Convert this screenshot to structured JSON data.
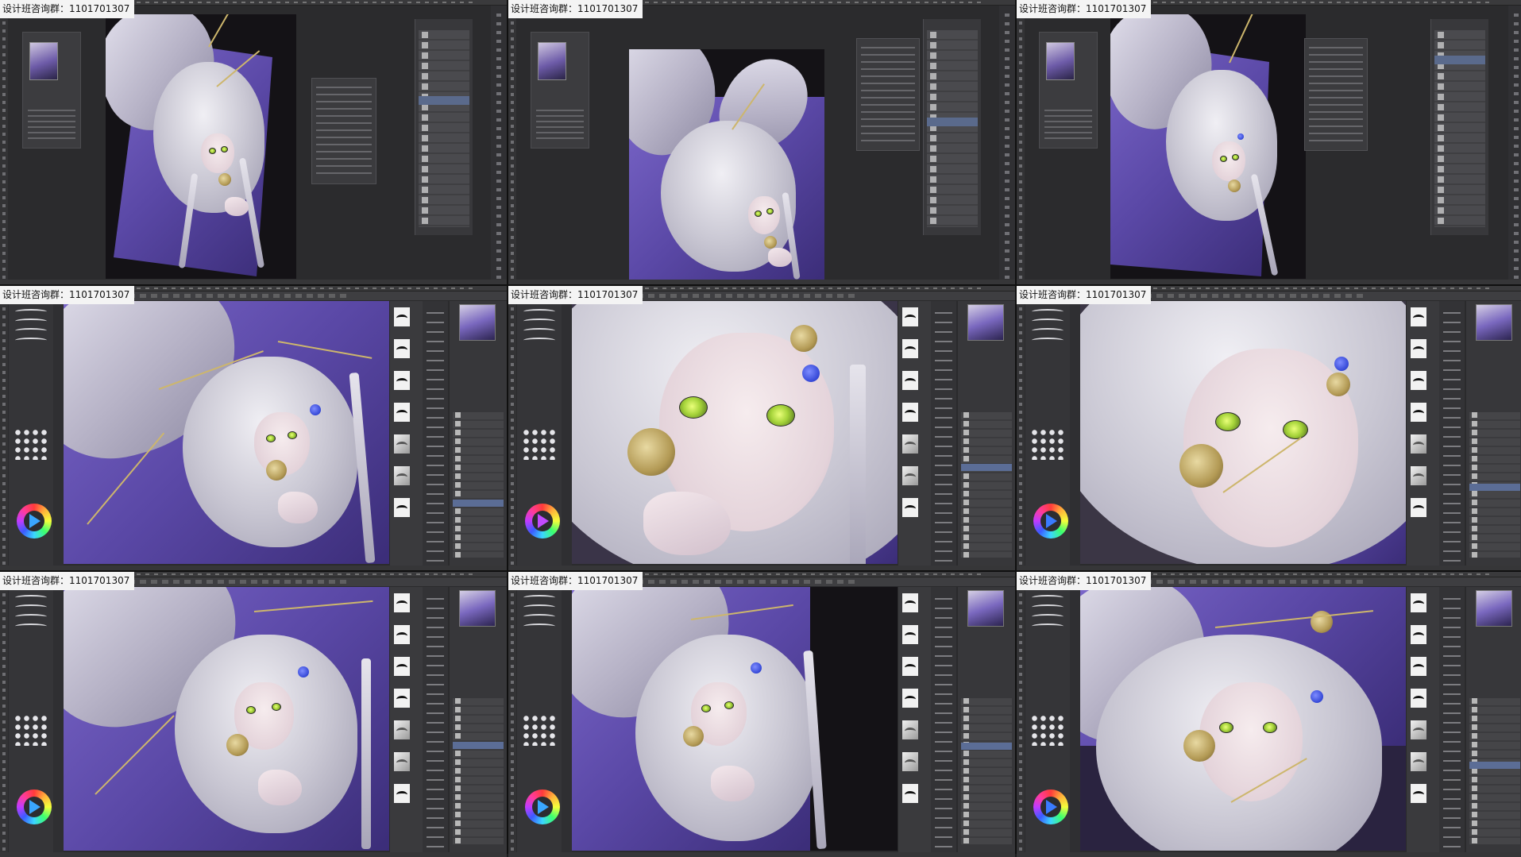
{
  "watermark_text": "设计班咨询群：1101701307",
  "grid": {
    "columns": 3,
    "rows": 3,
    "frames": 9
  },
  "frames": [
    {
      "id": "frame-1",
      "layout": "overview",
      "watermark": "设计班咨询群：1101701307"
    },
    {
      "id": "frame-2",
      "layout": "overview",
      "watermark": "设计班咨询群：1101701307"
    },
    {
      "id": "frame-3",
      "layout": "overview",
      "watermark": "设计班咨询群：1101701307"
    },
    {
      "id": "frame-4",
      "layout": "painting",
      "watermark": "设计班咨询群：1101701307"
    },
    {
      "id": "frame-5",
      "layout": "painting-closeup",
      "watermark": "设计班咨询群：1101701307"
    },
    {
      "id": "frame-6",
      "layout": "painting-closeup",
      "watermark": "设计班咨询群：1101701307"
    },
    {
      "id": "frame-7",
      "layout": "painting",
      "watermark": "设计班咨询群：1101701307"
    },
    {
      "id": "frame-8",
      "layout": "painting",
      "watermark": "设计班咨询群：1101701307"
    },
    {
      "id": "frame-9",
      "layout": "painting-closeup",
      "watermark": "设计班咨询群：1101701307"
    }
  ],
  "icons": {
    "color_wheel": "color-wheel-icon",
    "play_triangle": "play-triangle-icon",
    "brush_preset": "brush-preset-icon",
    "layer_thumbnail": "layer-thumbnail-icon",
    "navigator": "navigator-icon"
  },
  "colors": {
    "ui_dark": "#2b2b2d",
    "panel": "#38383b",
    "art_violet": "#6a56b8",
    "art_silver": "#cfcdd9",
    "eye_green": "#a6d43a",
    "gold": "#cdb66c",
    "selection_blue": "#5b6d96"
  }
}
